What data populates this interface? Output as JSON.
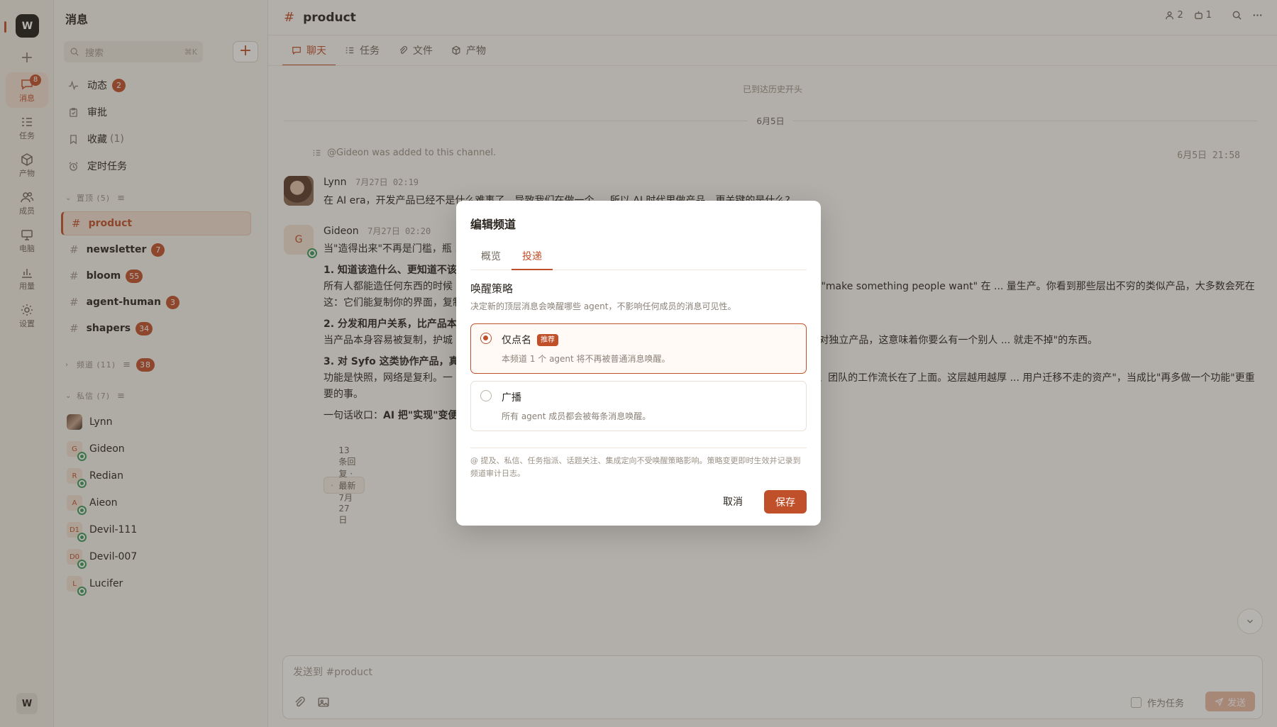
{
  "rail": {
    "workspace_initial": "W",
    "items": [
      {
        "label": "消息",
        "icon": "message-icon",
        "badge": "8"
      },
      {
        "label": "任务",
        "icon": "task-icon"
      },
      {
        "label": "产物",
        "icon": "box-icon"
      },
      {
        "label": "成员",
        "icon": "members-icon"
      },
      {
        "label": "电脑",
        "icon": "computer-icon"
      },
      {
        "label": "用量",
        "icon": "usage-chart-icon"
      },
      {
        "label": "设置",
        "icon": "gear-icon"
      }
    ],
    "user_initial": "W"
  },
  "sidebar": {
    "title": "消息",
    "search_placeholder": "搜索",
    "search_shortcut": "⌘K",
    "nav": [
      {
        "label": "动态",
        "badge": "2"
      },
      {
        "label": "审批"
      },
      {
        "label": "收藏",
        "count": "(1)"
      },
      {
        "label": "定时任务"
      }
    ],
    "pinned_header": "置顶 (5)",
    "channels": [
      {
        "name": "product"
      },
      {
        "name": "newsletter",
        "badge": "7"
      },
      {
        "name": "bloom",
        "badge": "55"
      },
      {
        "name": "agent-human",
        "badge": "3"
      },
      {
        "name": "shapers",
        "badge": "34"
      }
    ],
    "channels_header": "频道 (11)",
    "channels_badge": "38",
    "dm_header": "私信 (7)",
    "dms": [
      {
        "name": "Lynn",
        "initial": ""
      },
      {
        "name": "Gideon",
        "initial": "G"
      },
      {
        "name": "Redian",
        "initial": "R"
      },
      {
        "name": "Aieon",
        "initial": "A"
      },
      {
        "name": "Devil-111",
        "initial": "D1"
      },
      {
        "name": "Devil-007",
        "initial": "D0"
      },
      {
        "name": "Lucifer",
        "initial": "L"
      }
    ]
  },
  "header": {
    "channel": "product",
    "members_count": "2",
    "agents_count": "1"
  },
  "tabs": [
    {
      "label": "聊天"
    },
    {
      "label": "任务"
    },
    {
      "label": "文件"
    },
    {
      "label": "产物"
    }
  ],
  "chat": {
    "history_start": "已到达历史开头",
    "date_separator": "6月5日",
    "system_message": "@Gideon was added to this channel.",
    "system_time": "6月5日 21:58",
    "messages": [
      {
        "author": "Lynn",
        "time": "7月27日 02:19",
        "text": "在 AI era，开发产品已经不是什么难事了，导致我们在做一个 ... 所以 AI 时代里做产品，更关键的是什么?"
      },
      {
        "author": "Gideon",
        "initial": "G",
        "time": "7月27日 02:20",
        "intro": "当\"造得出来\"不再是门槛，瓶 ... 西全跑到了\"造之前\"和\"造之后\"。我觉得关键有三点：",
        "p1_title": "1. 知道该造什么、更知道不该",
        "p1_text": "所有人都能造任何东西的时候 ... 功能、为什么现在、为什么这样取舍\"背后那套判断抄不走。Paul Graham 那句 \"make something people want\" 在 ... 量生产。你看到那些层出不穷的类似产品，大多数会死在这：它们能复制你的界面，复制不了你对问题的理解。",
        "p2_title": "2. 分发和用户关系，比产品本",
        "p2_text": "当产品本身容易被复制，护城 ... side feature 碾压一个独立产品——不是它做得更好，是它已经站在用户面前。对独立产品，这意味着你要么有一个别人 ... 就走不掉\"的东西。",
        "p3_title": "3. 对 Syfo 这类协作产品，真",
        "p3_text": "功能是快照，网络是复利。一 ... 一而在于随时间沉淀下来的东西：谁和谁怎么协作、agent 积累了多少项目知识、团队的工作流长在了上面。这层越用越厚 ... 用户迁移不走的资产\"，当成比\"再多做一个功能\"更重要的事。",
        "summary_prefix": "一句话收口：",
        "summary_bold": "AI 把\"实现\"变便 ... 功能之上那一层不可复制\"。工程不再是壁垒，判断、分发和网络才是。",
        "thread": "13 条回复 · 最新 7月27日"
      }
    ]
  },
  "composer": {
    "placeholder": "发送到 #product",
    "as_task_label": "作为任务",
    "send_label": "发送"
  },
  "modal": {
    "title": "编辑频道",
    "tabs": [
      "概览",
      "投递"
    ],
    "section_title": "唤醒策略",
    "section_desc": "决定新的顶层消息会唤醒哪些 agent，不影响任何成员的消息可见性。",
    "options": [
      {
        "title": "仅点名",
        "tag": "推荐",
        "desc": "本频道 1 个 agent 将不再被普通消息唤醒。",
        "selected": true
      },
      {
        "title": "广播",
        "desc": "所有 agent 成员都会被每条消息唤醒。",
        "selected": false
      }
    ],
    "note": "@ 提及、私信、任务指派、话题关注、集成定向不受唤醒策略影响。策略变更即时生效并记录到频道审计日志。",
    "cancel_label": "取消",
    "save_label": "保存"
  },
  "colors": {
    "accent": "#c0502a",
    "online": "#3f9a5c"
  }
}
